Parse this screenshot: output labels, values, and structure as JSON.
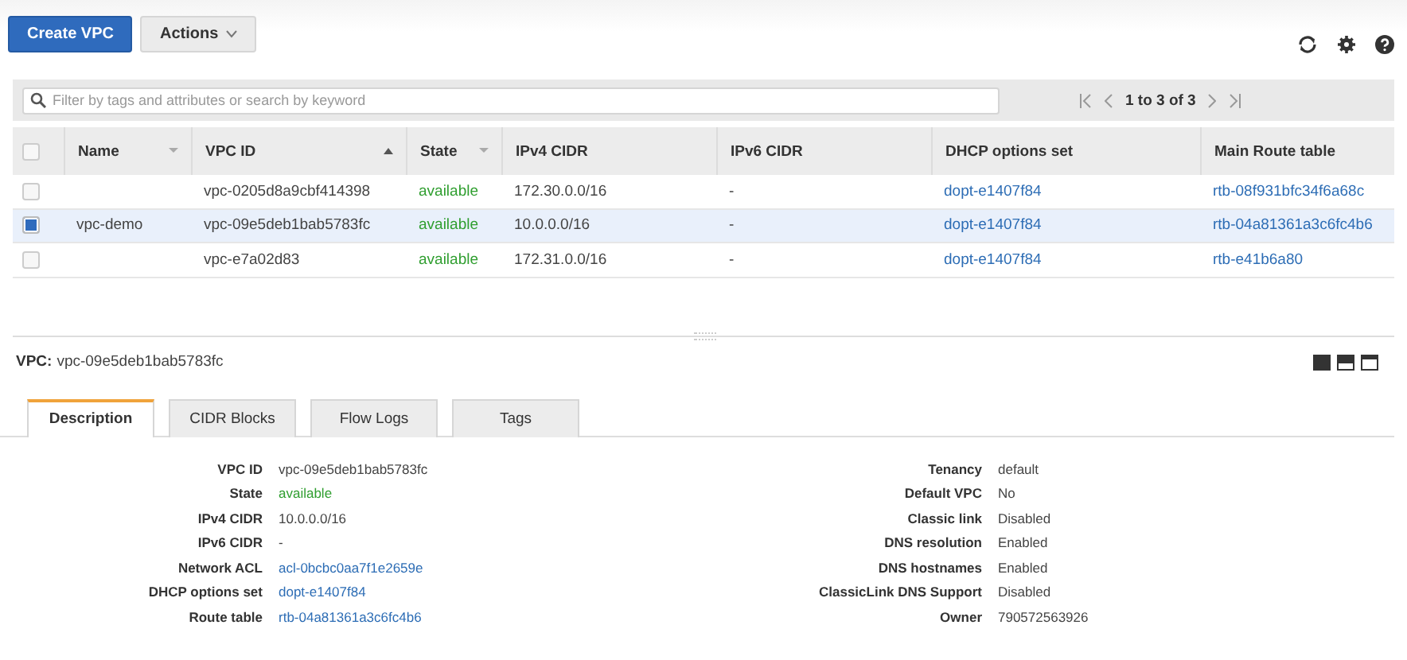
{
  "toolbar": {
    "buttons": [
      {
        "label": "Create VPC",
        "kind": "primary"
      },
      {
        "label": "Actions",
        "kind": "menu"
      }
    ]
  },
  "filter": {
    "placeholder": "Filter by tags and attributes or search by keyword",
    "pagination": "1 to 3 of 3"
  },
  "table": {
    "select_all": {
      "checked": false
    },
    "columns": [
      {
        "label": "Name",
        "kind": "text",
        "sorted": false
      },
      {
        "label": "VPC ID",
        "kind": "text",
        "sorted": true
      },
      {
        "label": "State",
        "kind": "status",
        "sorted": false
      },
      {
        "label": "IPv4 CIDR",
        "kind": "text"
      },
      {
        "label": "IPv6 CIDR",
        "kind": "text"
      },
      {
        "label": "DHCP options set",
        "kind": "link"
      },
      {
        "label": "Main Route table",
        "kind": "link"
      }
    ],
    "rows": [
      {
        "selected": false,
        "cells": [
          "",
          "vpc-0205d8a9cbf414398",
          "available",
          "172.30.0.0/16",
          "-",
          "dopt-e1407f84",
          "rtb-08f931bfc34f6a68c"
        ]
      },
      {
        "selected": true,
        "cells": [
          "vpc-demo",
          "vpc-09e5deb1bab5783fc",
          "available",
          "10.0.0.0/16",
          "-",
          "dopt-e1407f84",
          "rtb-04a81361a3c6fc4b6"
        ]
      },
      {
        "selected": false,
        "cells": [
          "",
          "vpc-e7a02d83",
          "available",
          "172.31.0.0/16",
          "-",
          "dopt-e1407f84",
          "rtb-e41b6a80"
        ]
      }
    ]
  },
  "details": {
    "label": "VPC:",
    "value": "vpc-09e5deb1bab5783fc",
    "tabs": [
      {
        "label": "Description",
        "selected": true
      },
      {
        "label": "CIDR Blocks",
        "selected": false
      },
      {
        "label": "Flow Logs",
        "selected": false
      },
      {
        "label": "Tags",
        "selected": false
      }
    ],
    "left": [
      {
        "label": "VPC ID",
        "value": "vpc-09e5deb1bab5783fc",
        "kind": "text"
      },
      {
        "label": "State",
        "value": "available",
        "kind": "status"
      },
      {
        "label": "IPv4 CIDR",
        "value": "10.0.0.0/16",
        "kind": "text"
      },
      {
        "label": "IPv6 CIDR",
        "value": "-",
        "kind": "text"
      },
      {
        "label": "Network ACL",
        "value": "acl-0bcbc0aa7f1e2659e",
        "kind": "link"
      },
      {
        "label": "DHCP options set",
        "value": "dopt-e1407f84",
        "kind": "link"
      },
      {
        "label": "Route table",
        "value": "rtb-04a81361a3c6fc4b6",
        "kind": "link"
      }
    ],
    "right": [
      {
        "label": "Tenancy",
        "value": "default"
      },
      {
        "label": "Default VPC",
        "value": "No"
      },
      {
        "label": "Classic link",
        "value": "Disabled"
      },
      {
        "label": "DNS resolution",
        "value": "Enabled"
      },
      {
        "label": "DNS hostnames",
        "value": "Enabled"
      },
      {
        "label": "ClassicLink DNS Support",
        "value": "Disabled"
      },
      {
        "label": "Owner",
        "value": "790572563926"
      }
    ]
  }
}
